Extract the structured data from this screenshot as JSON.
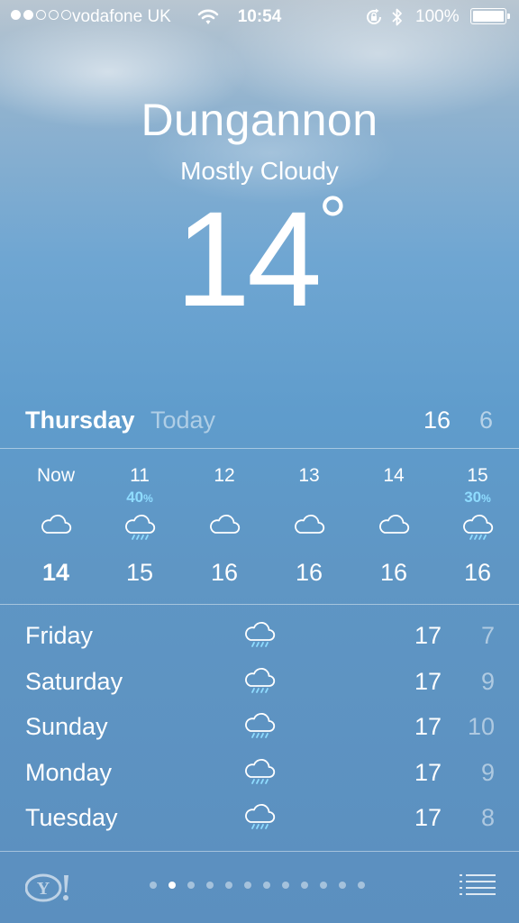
{
  "status": {
    "carrier": "vodafone UK",
    "time": "10:54",
    "battery": "100%",
    "signal_strength": 2,
    "battery_level": 1.0
  },
  "location": {
    "city": "Dungannon",
    "condition": "Mostly Cloudy",
    "temperature": "14",
    "degree": "°"
  },
  "today": {
    "day": "Thursday",
    "label": "Today",
    "high": "16",
    "low": "6"
  },
  "hourly": [
    {
      "time": "Now",
      "precip": "",
      "unit": "",
      "icon": "cloud-icon",
      "temp": "14"
    },
    {
      "time": "11",
      "precip": "40",
      "unit": "%",
      "icon": "rain-icon",
      "temp": "15"
    },
    {
      "time": "12",
      "precip": "",
      "unit": "",
      "icon": "cloud-icon",
      "temp": "16"
    },
    {
      "time": "13",
      "precip": "",
      "unit": "",
      "icon": "cloud-icon",
      "temp": "16"
    },
    {
      "time": "14",
      "precip": "",
      "unit": "",
      "icon": "cloud-icon",
      "temp": "16"
    },
    {
      "time": "15",
      "precip": "30",
      "unit": "%",
      "icon": "rain-icon",
      "temp": "16"
    }
  ],
  "daily": [
    {
      "day": "Friday",
      "icon": "rain-icon",
      "high": "17",
      "low": "7"
    },
    {
      "day": "Saturday",
      "icon": "rain-icon",
      "high": "17",
      "low": "9"
    },
    {
      "day": "Sunday",
      "icon": "rain-icon",
      "high": "17",
      "low": "10"
    },
    {
      "day": "Monday",
      "icon": "rain-icon",
      "high": "17",
      "low": "9"
    },
    {
      "day": "Tuesday",
      "icon": "rain-icon",
      "high": "17",
      "low": "8"
    }
  ],
  "footer": {
    "logo": "Y!",
    "page_count": 12,
    "active_page": 2,
    "list_icon": "list-icon"
  },
  "colors": {
    "precip": "#8fdcff",
    "sky_top": "#b9c6d1",
    "sky_bottom": "#5b8fbf"
  }
}
